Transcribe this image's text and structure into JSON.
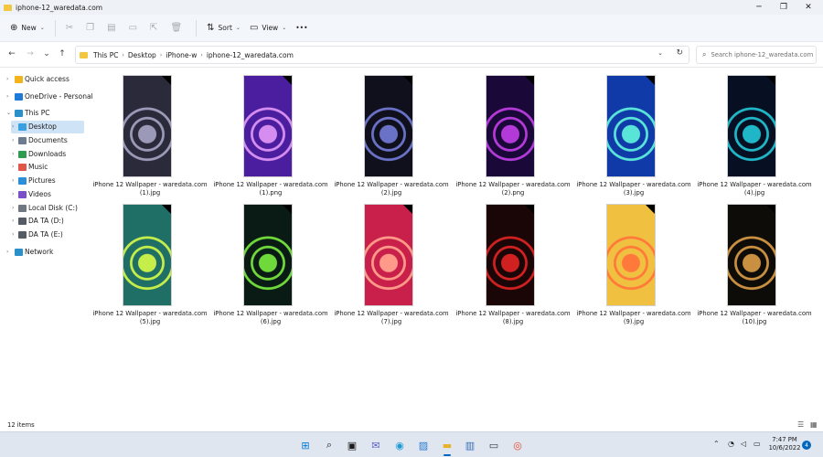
{
  "window": {
    "title": "iphone-12_waredata.com",
    "controls": {
      "minimize": "─",
      "maximize": "❐",
      "close": "✕"
    }
  },
  "toolbar": {
    "new_label": "New",
    "sort_label": "Sort",
    "view_label": "View",
    "more_label": "•••"
  },
  "address": {
    "crumbs": [
      "This PC",
      "Desktop",
      "iPhone-w",
      "iphone-12_waredata.com"
    ],
    "search_placeholder": "Search iphone-12_waredata.com"
  },
  "sidebar": {
    "items": [
      {
        "label": "Quick access",
        "icon": "star-icon",
        "color": "#f2b31b"
      },
      {
        "label": "OneDrive - Personal",
        "icon": "cloud-icon",
        "color": "#1f7ad8"
      },
      {
        "label": "This PC",
        "icon": "monitor-icon",
        "color": "#2b8fc9"
      },
      {
        "label": "Desktop",
        "icon": "desktop-icon",
        "color": "#3aa0e0"
      },
      {
        "label": "Documents",
        "icon": "documents-icon",
        "color": "#6c7b8d"
      },
      {
        "label": "Downloads",
        "icon": "downloads-icon",
        "color": "#2e9b4e"
      },
      {
        "label": "Music",
        "icon": "music-icon",
        "color": "#e0574a"
      },
      {
        "label": "Pictures",
        "icon": "pictures-icon",
        "color": "#2a8fd8"
      },
      {
        "label": "Videos",
        "icon": "videos-icon",
        "color": "#7b4fc8"
      },
      {
        "label": "Local Disk (C:)",
        "icon": "disk-icon",
        "color": "#6f7780"
      },
      {
        "label": "DA TA (D:)",
        "icon": "drive-icon",
        "color": "#555b62"
      },
      {
        "label": "DA TA (E:)",
        "icon": "drive-icon",
        "color": "#555b62"
      },
      {
        "label": "Network",
        "icon": "network-icon",
        "color": "#2b8fc9"
      }
    ]
  },
  "files": [
    {
      "caption1": "iPhone 12 Wallpaper - waredata.com",
      "caption2": "(1).jpg",
      "bg": "#2a2a3a",
      "ring": "#9a9ab8"
    },
    {
      "caption1": "iPhone 12 Wallpaper - waredata.com",
      "caption2": "(1).png",
      "bg": "#4a1e9e",
      "ring": "#d58ef0"
    },
    {
      "caption1": "iPhone 12 Wallpaper - waredata.com",
      "caption2": "(2).jpg",
      "bg": "#10101c",
      "ring": "#6a72c8"
    },
    {
      "caption1": "iPhone 12 Wallpaper - waredata.com",
      "caption2": "(2).png",
      "bg": "#1a0838",
      "ring": "#b33ad8"
    },
    {
      "caption1": "iPhone 12 Wallpaper - waredata.com",
      "caption2": "(3).jpg",
      "bg": "#0f3aa8",
      "ring": "#59e4d8"
    },
    {
      "caption1": "iPhone 12 Wallpaper - waredata.com",
      "caption2": "(4).jpg",
      "bg": "#071022",
      "ring": "#1fb7c8"
    },
    {
      "caption1": "iPhone 12 Wallpaper - waredata.com",
      "caption2": "(5).jpg",
      "bg": "#1f6f66",
      "ring": "#c6ee4a"
    },
    {
      "caption1": "iPhone 12 Wallpaper - waredata.com",
      "caption2": "(6).jpg",
      "bg": "#0a1a14",
      "ring": "#6fd83a"
    },
    {
      "caption1": "iPhone 12 Wallpaper - waredata.com",
      "caption2": "(7).jpg",
      "bg": "#c8204a",
      "ring": "#ff9a8a"
    },
    {
      "caption1": "iPhone 12 Wallpaper - waredata.com",
      "caption2": "(8).jpg",
      "bg": "#1a0606",
      "ring": "#d02020"
    },
    {
      "caption1": "iPhone 12 Wallpaper - waredata.com",
      "caption2": "(9).jpg",
      "bg": "#f0c040",
      "ring": "#ff7a3a"
    },
    {
      "caption1": "iPhone 12 Wallpaper - waredata.com",
      "caption2": "(10).jpg",
      "bg": "#0e0c08",
      "ring": "#c89040"
    }
  ],
  "status": {
    "item_count": "12 items"
  },
  "taskbar": {
    "time": "7:47 PM",
    "date": "10/6/2022",
    "notifications": "4"
  }
}
